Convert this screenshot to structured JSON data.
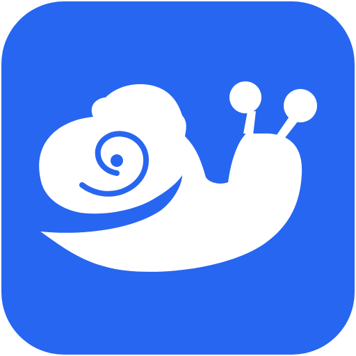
{
  "icon": {
    "name": "snail-app-icon",
    "depicts": "snail-icon",
    "background_color": "#2766F0",
    "foreground_color": "#FFFFFF",
    "page_background_color": "#FFFFFF"
  }
}
